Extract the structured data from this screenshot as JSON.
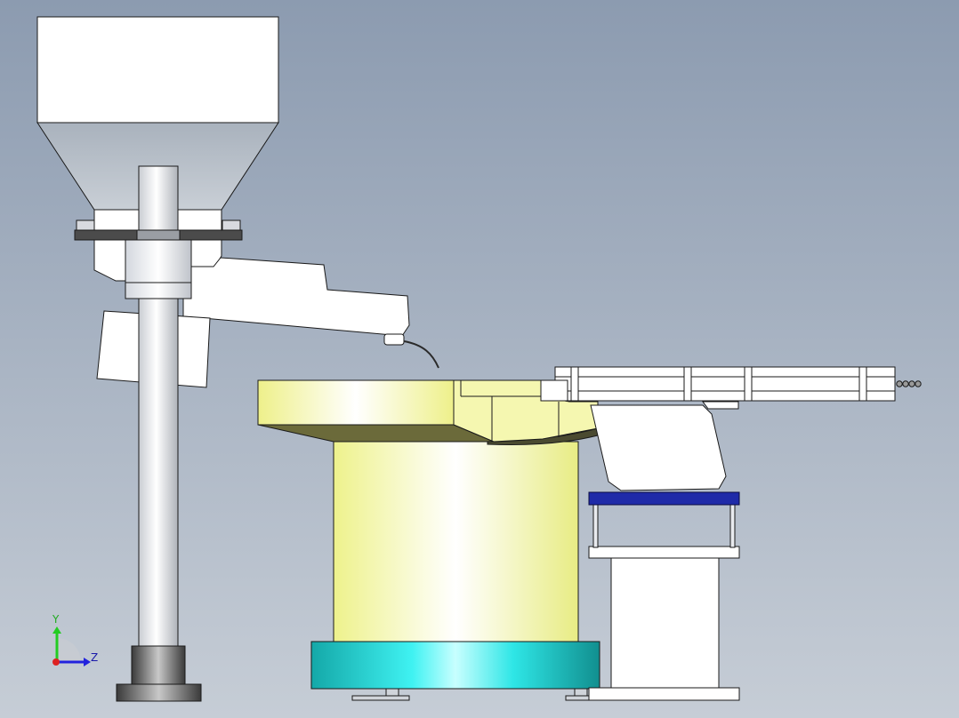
{
  "viewport": {
    "background_top": "#8c9bb0",
    "background_bottom": "#c6cdd6"
  },
  "triad": {
    "y_label": "Y",
    "z_label": "Z",
    "y_color": "#22cc22",
    "z_color": "#2222dd",
    "origin_color": "#dd2222"
  },
  "colors": {
    "outline": "#1a1a1a",
    "white_part": "#ffffff",
    "hopper_cone": "#b4bcc6",
    "steel_light": "#e8eaee",
    "steel_dark": "#7a7e84",
    "dark_plate": "#4b4b4b",
    "bowl_yellow": "#f3f59a",
    "bowl_shadow": "#6b6a3a",
    "base_cyan": "#22d8d8",
    "base_cyan_dark": "#129a9a",
    "blue_plate": "#1f2aa8",
    "base_cylinder_white": "#fafaf2"
  },
  "parts": [
    "hopper-box",
    "hopper-cone",
    "hopper-flange",
    "vertical-column",
    "column-base",
    "swing-arm",
    "vibratory-bowl",
    "bowl-base-ring",
    "linear-feeder-track",
    "linear-feeder-bracket",
    "blue-mount-plate",
    "support-pedestal"
  ]
}
